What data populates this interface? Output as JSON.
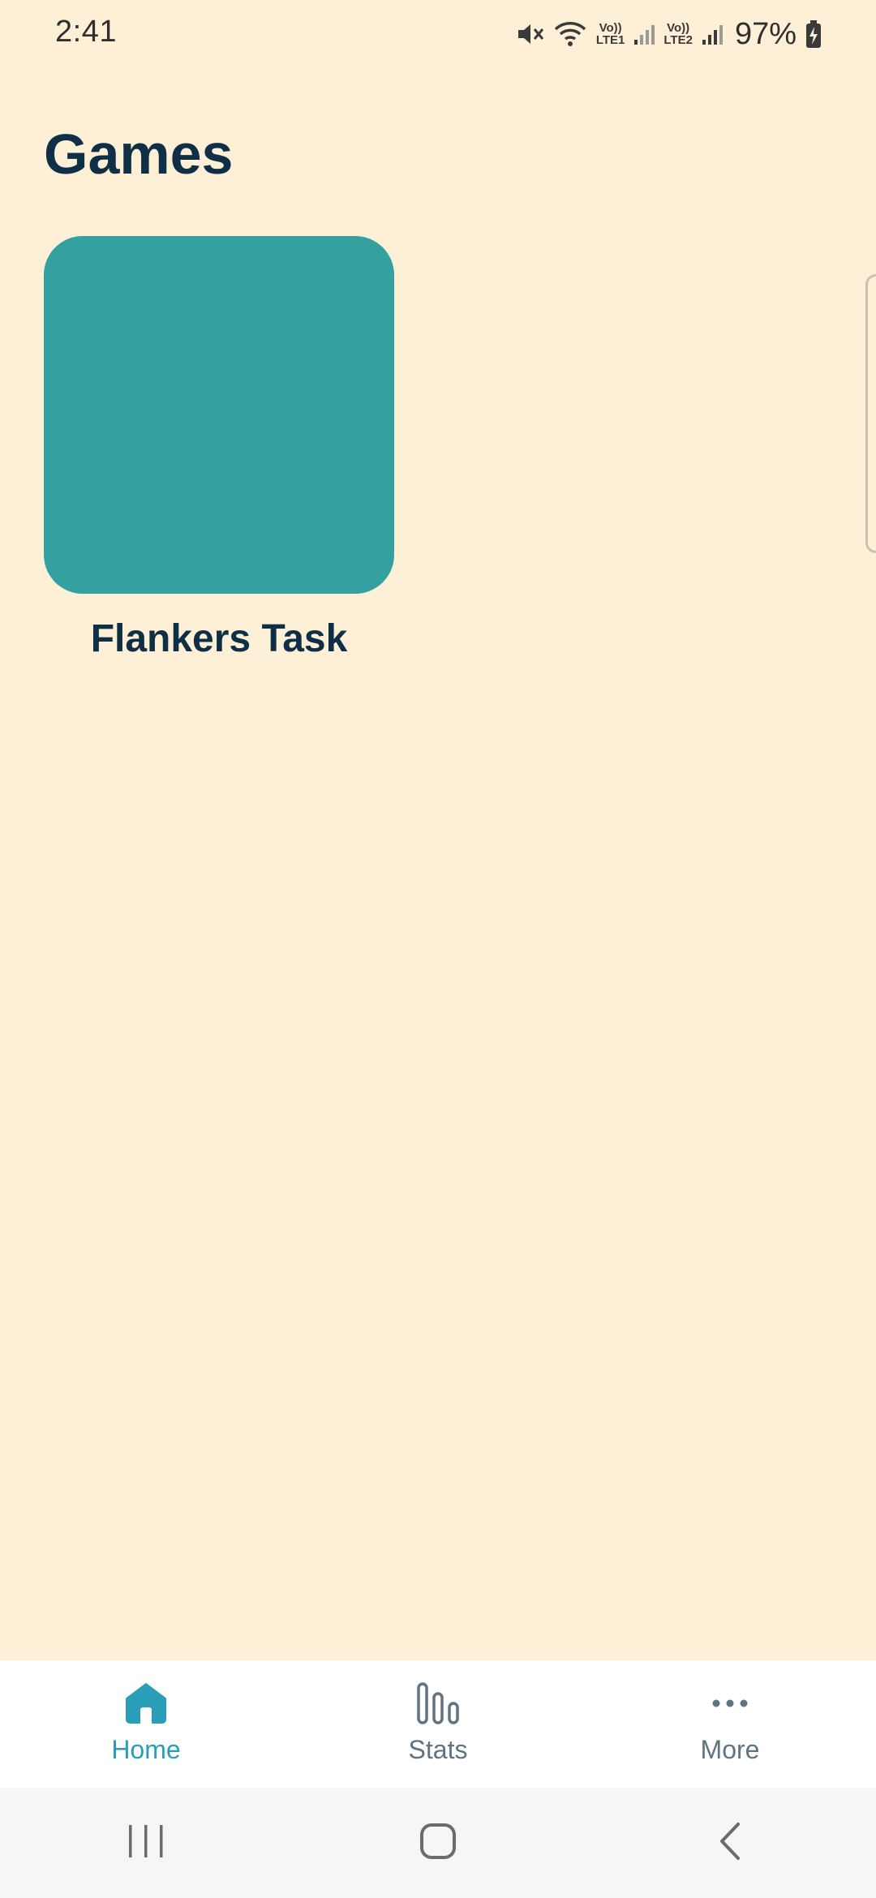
{
  "status_bar": {
    "time": "2:41",
    "battery_percent": "97%",
    "sim1_top": "Vo))",
    "sim1_bottom": "LTE1",
    "sim2_top": "Vo))",
    "sim2_bottom": "LTE2",
    "icons": [
      "mute-icon",
      "wifi-icon",
      "signal-icon",
      "signal-icon",
      "battery-charging-icon"
    ]
  },
  "page": {
    "title": "Games"
  },
  "games": [
    {
      "label": "Flankers Task",
      "tile_color": "#34A0A0"
    }
  ],
  "bottom_nav": {
    "items": [
      {
        "label": "Home",
        "icon": "home-icon",
        "active": true
      },
      {
        "label": "Stats",
        "icon": "stats-icon",
        "active": false
      },
      {
        "label": "More",
        "icon": "more-icon",
        "active": false
      }
    ],
    "active_color": "#2A9DB8",
    "inactive_color": "#5F7380"
  },
  "system_nav": {
    "buttons": [
      "recents-icon",
      "home-circle-icon",
      "back-icon"
    ]
  },
  "colors": {
    "background": "#FEF0D7",
    "title": "#0E2F45"
  }
}
